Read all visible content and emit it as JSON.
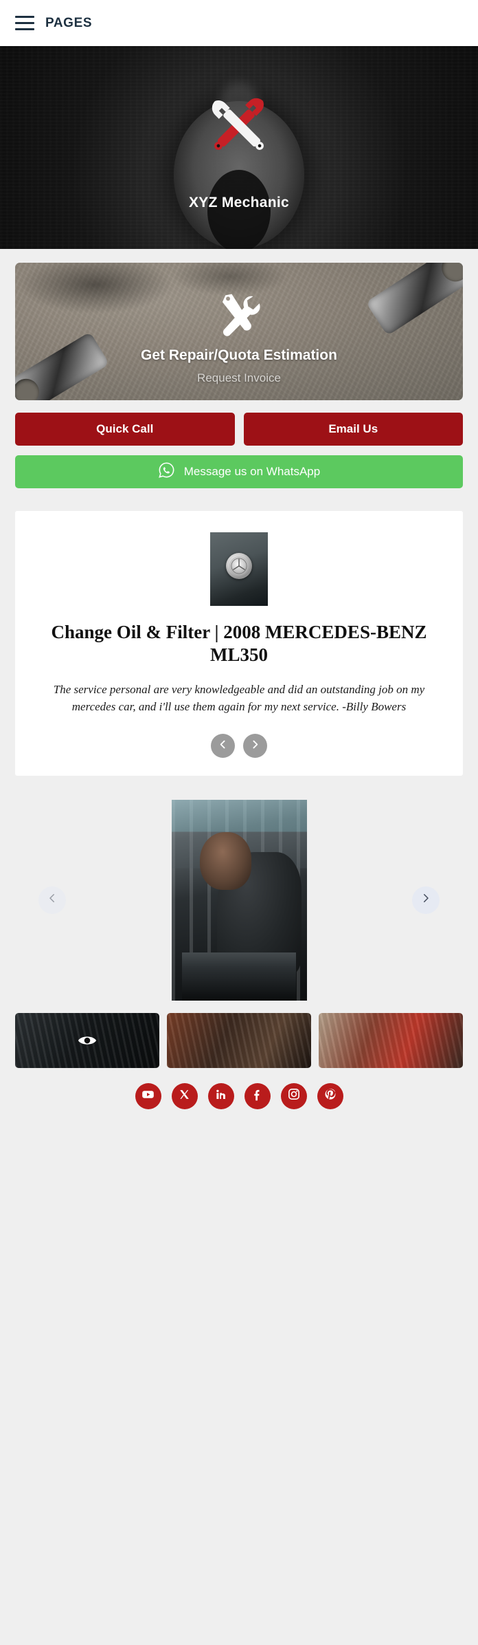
{
  "header": {
    "menu_icon": "hamburger-icon",
    "title": "PAGES"
  },
  "hero": {
    "title": "XYZ Mechanic",
    "icon": "crossed-wrenches-icon",
    "wrench_red": "#c62026",
    "wrench_white": "#f4f4f4",
    "background": "#151515"
  },
  "estimate": {
    "icon": "tools-screwdriver-wrench-icon",
    "title": "Get Repair/Quota Estimation",
    "subtitle": "Request Invoice"
  },
  "actions": {
    "quick_call": "Quick Call",
    "email_us": "Email Us",
    "whatsapp": "Message us on WhatsApp",
    "whatsapp_icon": "whatsapp-icon",
    "red": "#9d1116",
    "green": "#5cc95f"
  },
  "testimonial": {
    "image_alt": "mercedes-benz-emblem-photo",
    "title": "Change Oil & Filter | 2008 MERCEDES-BENZ ML350",
    "quote": "The service personal are very knowledgeable and did an outstanding job on my mercedes car, and i'll use them again for my next service. -Billy Bowers",
    "prev_label": "prev-testimonial",
    "next_label": "next-testimonial"
  },
  "gallery": {
    "main_alt": "mechanic-working-under-hood-photo",
    "prev_label": "prev-gallery-image",
    "next_label": "next-gallery-image",
    "thumbs": [
      {
        "alt": "engine-bay-closeup-thumbnail",
        "badge": "eye-icon"
      },
      {
        "alt": "hands-with-tool-thumbnail",
        "badge": ""
      },
      {
        "alt": "garage-interior-thumbnail",
        "badge": ""
      }
    ]
  },
  "social": [
    {
      "name": "youtube",
      "label": "YouTube"
    },
    {
      "name": "x-twitter",
      "label": "X"
    },
    {
      "name": "linkedin",
      "label": "LinkedIn"
    },
    {
      "name": "facebook",
      "label": "Facebook"
    },
    {
      "name": "instagram",
      "label": "Instagram"
    },
    {
      "name": "pinterest",
      "label": "Pinterest"
    }
  ],
  "colors": {
    "brand_red": "#b91c1c",
    "navy": "#1d3040",
    "page_bg": "#efefef"
  }
}
